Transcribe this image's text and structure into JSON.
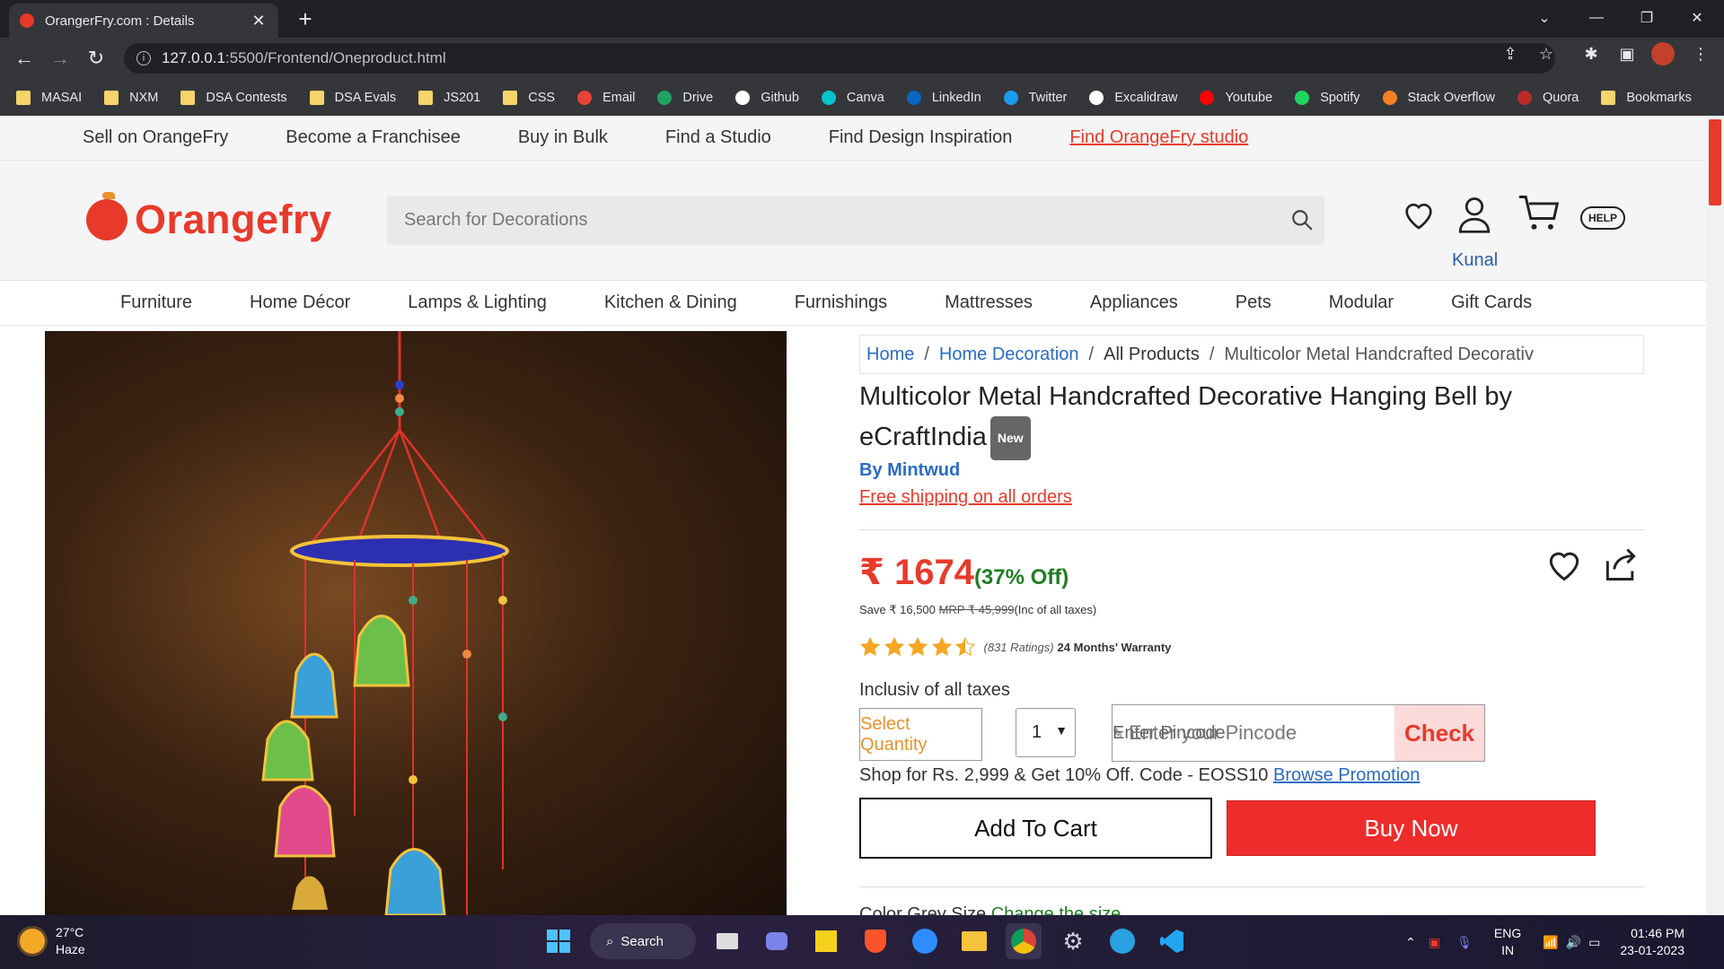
{
  "browser": {
    "tab_title": "OrangerFry.com : Details",
    "tab_close": "✕",
    "new_tab": "+",
    "url_host": "127.0.0.1",
    "url_path": ":5500/Frontend/Oneproduct.html",
    "bookmarks": [
      "MASAI",
      "NXM",
      "DSA Contests",
      "DSA Evals",
      "JS201",
      "CSS",
      "Email",
      "Drive",
      "Github",
      "Canva",
      "LinkedIn",
      "Twitter",
      "Excalidraw",
      "Youtube",
      "Spotify",
      "Stack Overflow",
      "Quora",
      "Bookmarks"
    ]
  },
  "topstrip": {
    "links": [
      "Sell on OrangeFry",
      "Become a Franchisee",
      "Buy in Bulk",
      "Find a Studio",
      "Find Design Inspiration"
    ],
    "pincode_label": "Enter Pincode",
    "studio_link": "Find OrangeFry studio"
  },
  "header": {
    "logo_text": "Orangefry",
    "search_placeholder": "Search for Decorations",
    "user_name": "Kunal",
    "help_label": "HELP"
  },
  "categories": [
    "Furniture",
    "Home Décor",
    "Lamps & Lighting",
    "Kitchen & Dining",
    "Furnishings",
    "Mattresses",
    "Appliances",
    "Pets",
    "Modular",
    "Gift Cards"
  ],
  "product": {
    "breadcrumbs": [
      "Home",
      "Home Decoration",
      "All Products",
      "Multicolor Metal Handcrafted Decorativ"
    ],
    "title": "Multicolor Metal Handcrafted Decorative Hanging Bell by eCraftIndia",
    "badge": "New",
    "brand": "By Mintwud",
    "shipping": "Free shipping on all orders",
    "price": "₹ 1674",
    "discount": "(37% Off)",
    "save_text": "Save ₹ 16,500",
    "mrp": "MRP ₹ 45,999",
    "tax_note": "(Inc of all taxes)",
    "rating_value": 4.5,
    "ratings_count": "(831 Ratings)",
    "warranty": "24 Months' Warranty",
    "inclusive": "Inclusiv of all taxes",
    "select_quantity": "Select Quantity",
    "quantity": "1",
    "pincode_placeholder": "Enter your Pincode",
    "check_label": "Check",
    "promo_text": "Shop for Rs. 2,999 & Get 10% Off. Code - EOSS10",
    "promo_link": "Browse Promotion",
    "add_to_cart": "Add To Cart",
    "buy_now": "Buy Now",
    "cut_prefix": "Color  Grey  Size  ",
    "cut_link": "Change the size"
  },
  "taskbar": {
    "temperature": "27°C",
    "weather": "Haze",
    "search_label": "Search",
    "lang_1": "ENG",
    "lang_2": "IN",
    "time": "01:46 PM",
    "date": "23-01-2023"
  },
  "colors": {
    "brand": "#e83a2b",
    "link": "#2a6cc4",
    "discount": "#1e7d22",
    "buy": "#ee2c2c"
  }
}
